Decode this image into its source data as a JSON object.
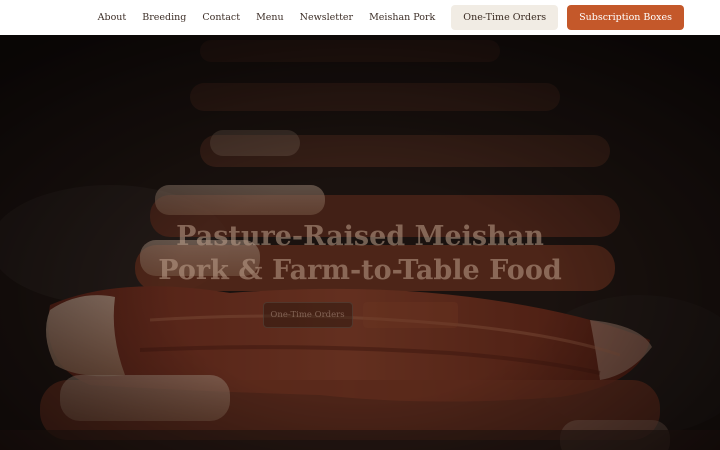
{
  "nav": {
    "links": [
      "About",
      "Breeding",
      "Contact",
      "Menu",
      "Newsletter",
      "Meishan Pork"
    ],
    "one_time_orders": "One-Time Orders",
    "subscription_boxes": "Subscription Boxes"
  },
  "hero": {
    "title": "Pasture-Raised Meishan Pork & Farm-to-Table Food",
    "subtitle": "",
    "primary_button": "One-Time Orders",
    "secondary_button": "",
    "image_subject": "bacon strips sizzling on a griddle"
  },
  "colors": {
    "accent": "#c4582a",
    "light_button": "#f1ece4",
    "header_bg": "#ffffff",
    "nav_text": "#3d2f28"
  }
}
